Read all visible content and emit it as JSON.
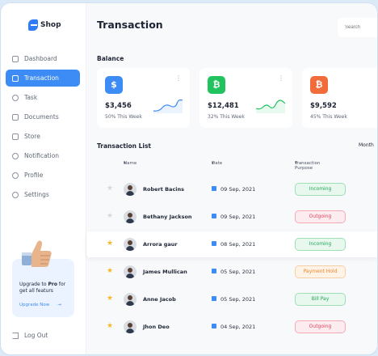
{
  "app": {
    "logo_text": "Shop"
  },
  "sidebar": {
    "items": [
      {
        "label": "Dashboard",
        "active": false
      },
      {
        "label": "Transaction",
        "active": true
      },
      {
        "label": "Task",
        "active": false
      },
      {
        "label": "Documents",
        "active": false
      },
      {
        "label": "Store",
        "active": false
      },
      {
        "label": "Notification",
        "active": false
      },
      {
        "label": "Profile",
        "active": false
      },
      {
        "label": "Settings",
        "active": false
      }
    ],
    "upgrade": {
      "text_pre": "Upgrade to ",
      "text_bold": "Pro",
      "text_post": " for get all featurs",
      "link": "Upgrade Now",
      "arrow": "→"
    },
    "logout": "Log Out"
  },
  "header": {
    "title": "Transaction",
    "search_placeholder": "Search"
  },
  "balance": {
    "label": "Balance",
    "cards": [
      {
        "icon": "dollar-icon",
        "glyph": "$",
        "color": "#3d8bf5",
        "amount": "$3,456",
        "sub": "50% This Week",
        "trend_color": "#3d8bf5"
      },
      {
        "icon": "bitcoin-icon",
        "glyph": "₿",
        "color": "#22c35e",
        "amount": "$12,481",
        "sub": "32% This Week",
        "trend_color": "#22c35e"
      },
      {
        "icon": "coin-icon",
        "glyph": "₿",
        "color": "#f26b3a",
        "amount": "$9,592",
        "sub": "45% This Week",
        "trend_color": "#f26b3a"
      }
    ]
  },
  "transactions": {
    "label": "Transaction List",
    "sort_link": "Month",
    "columns": {
      "name": "Name",
      "date": "Date",
      "purpose": "Transaction Purpose"
    },
    "rows": [
      {
        "starred": false,
        "name": "Robert Bacins",
        "date": "09 Sep, 2021",
        "purpose": "Incoming",
        "tone": "green"
      },
      {
        "starred": false,
        "name": "Bethany Jackson",
        "date": "09 Sep, 2021",
        "purpose": "Outgoing",
        "tone": "red"
      },
      {
        "starred": true,
        "name": "Arrora gaur",
        "date": "08 Sep, 2021",
        "purpose": "Incoming",
        "tone": "green"
      },
      {
        "starred": true,
        "name": "James Mullican",
        "date": "05 Sep, 2021",
        "purpose": "Payment Hold",
        "tone": "orange"
      },
      {
        "starred": true,
        "name": "Anne Jacob",
        "date": "05 Sep, 2021",
        "purpose": "Bill Pay",
        "tone": "green"
      },
      {
        "starred": true,
        "name": "Jhon Deo",
        "date": "04 Sep, 2021",
        "purpose": "Outgoing",
        "tone": "red"
      }
    ]
  },
  "colors": {
    "accent": "#3d8bf5",
    "star_on": "#f5b82e",
    "star_off": "#d4d8df"
  }
}
